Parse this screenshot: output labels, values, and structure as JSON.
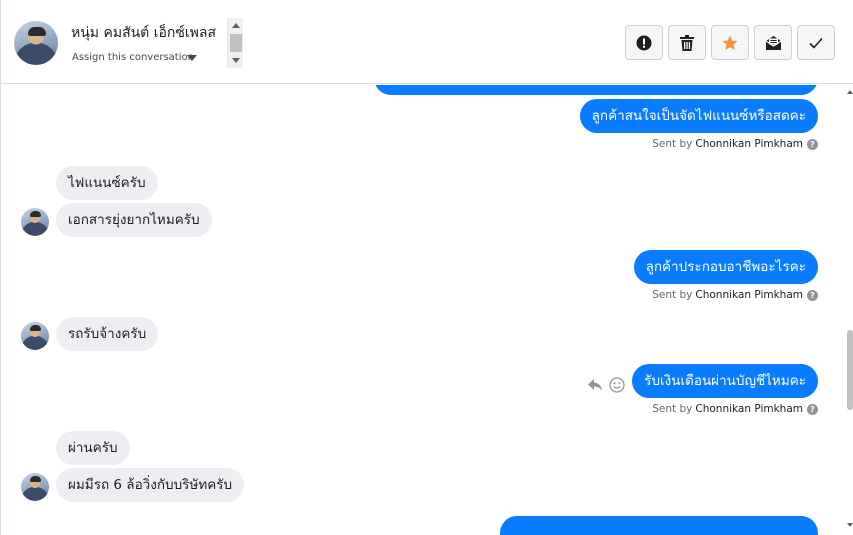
{
  "header": {
    "contact_name": "หนุ่ม คมสันต์ เอ็กซ์เพลส",
    "assign_label": "Assign this conversation"
  },
  "toolbar": {
    "spam_icon": "exclamation-circle-icon",
    "delete_icon": "trash-icon",
    "star_icon": "star-icon",
    "unread_icon": "envelope-icon",
    "done_icon": "checkmark-icon",
    "star_color": "#f7923a"
  },
  "messages": [
    {
      "dir": "out",
      "text": "ลูกค้าสนใจเป็นจัดไฟแนนซ์หรือสดคะ"
    },
    {
      "dir": "in",
      "text": "ไฟแนนซ์ครับ"
    },
    {
      "dir": "in",
      "text": "เอกสารยุ่งยากไหมครับ"
    },
    {
      "dir": "out",
      "text": "ลูกค้าประกอบอาชีพอะไรคะ"
    },
    {
      "dir": "in",
      "text": "รถรับจ้างครับ"
    },
    {
      "dir": "out",
      "text": "รับเงินเดือนผ่านบัญชีไหมคะ"
    },
    {
      "dir": "in",
      "text": "ผ่านครับ"
    },
    {
      "dir": "in",
      "text": "ผมมีรถ 6 ล้อวิ่งกับบริษัทครับ"
    }
  ],
  "sent_by": {
    "prefix": "Sent by",
    "name": "Chonnikan Pimkham"
  },
  "colors": {
    "outgoing_bubble": "#0a7cff",
    "incoming_bubble": "#eceef1"
  }
}
